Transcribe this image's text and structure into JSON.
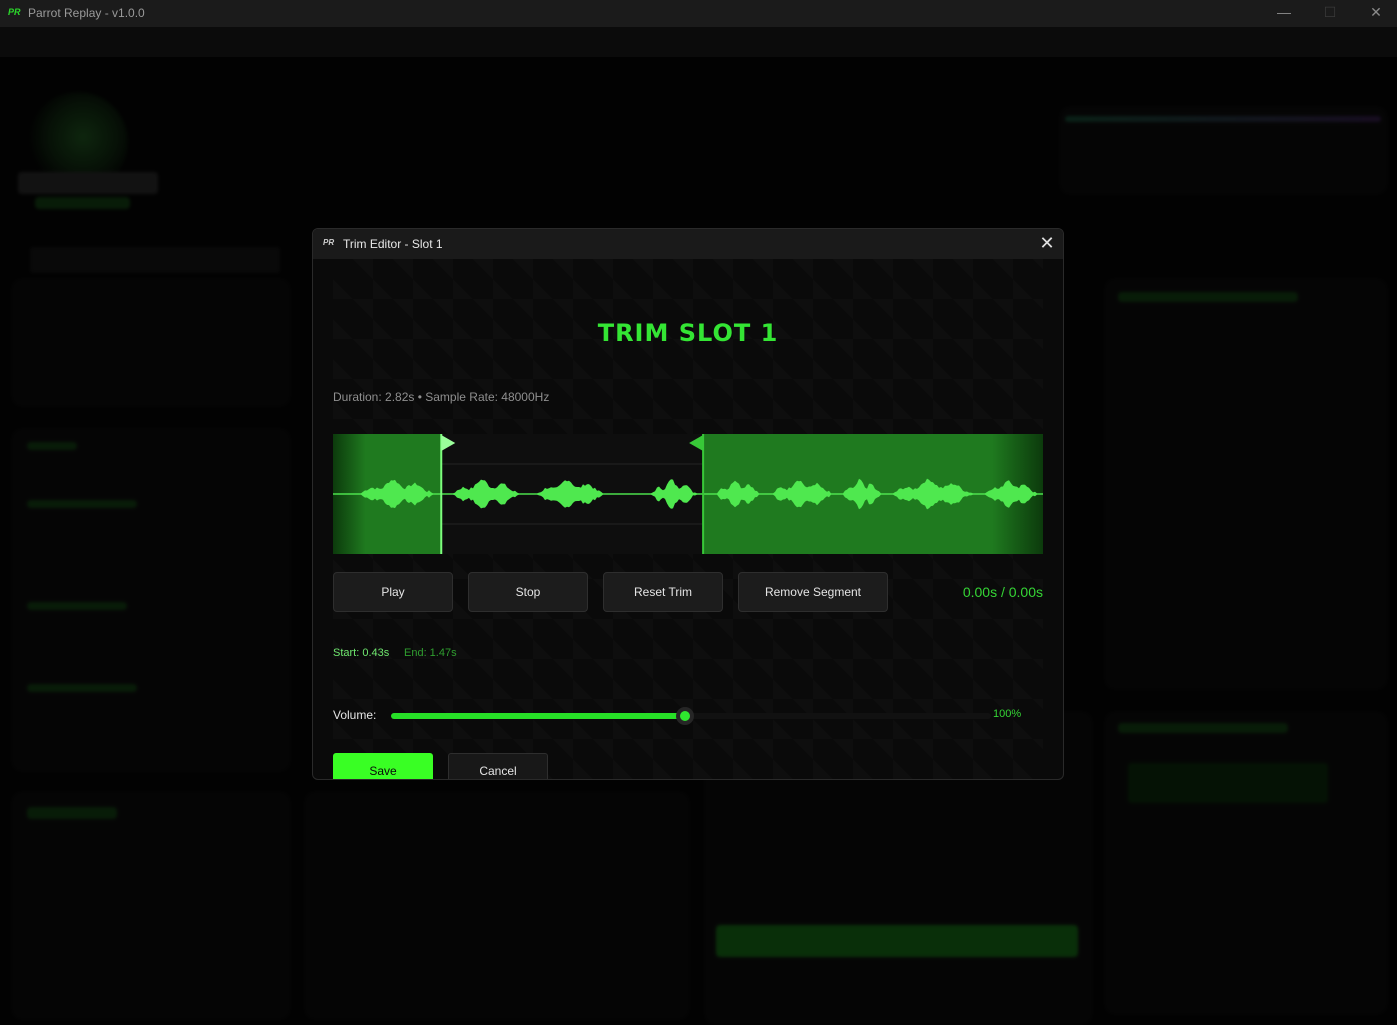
{
  "app": {
    "title": "Parrot Replay - v1.0.0",
    "logo_text": "PR",
    "window_controls": {
      "minimize": "—",
      "maximize": "☐",
      "close": "✕"
    }
  },
  "dialog": {
    "title": "Trim Editor - Slot 1",
    "close_glyph": "✕",
    "heading": "TRIM SLOT 1",
    "info": "Duration: 2.82s • Sample Rate: 48000Hz",
    "buttons": {
      "play": "Play",
      "stop": "Stop",
      "reset": "Reset Trim",
      "remove": "Remove Segment"
    },
    "time_display": "0.00s / 0.00s",
    "start_label": "Start: 0.43s",
    "end_label": "End: 1.47s",
    "trim": {
      "duration": 2.82,
      "start": 0.43,
      "end": 1.47
    },
    "volume": {
      "label": "Volume:",
      "value_text": "100%",
      "level": 0.49
    },
    "save": "Save",
    "cancel": "Cancel"
  },
  "colors": {
    "accent": "#39ff24",
    "wave": "#4fe84f",
    "trimmed_region": "#1f7a1f",
    "background": "#050505"
  }
}
